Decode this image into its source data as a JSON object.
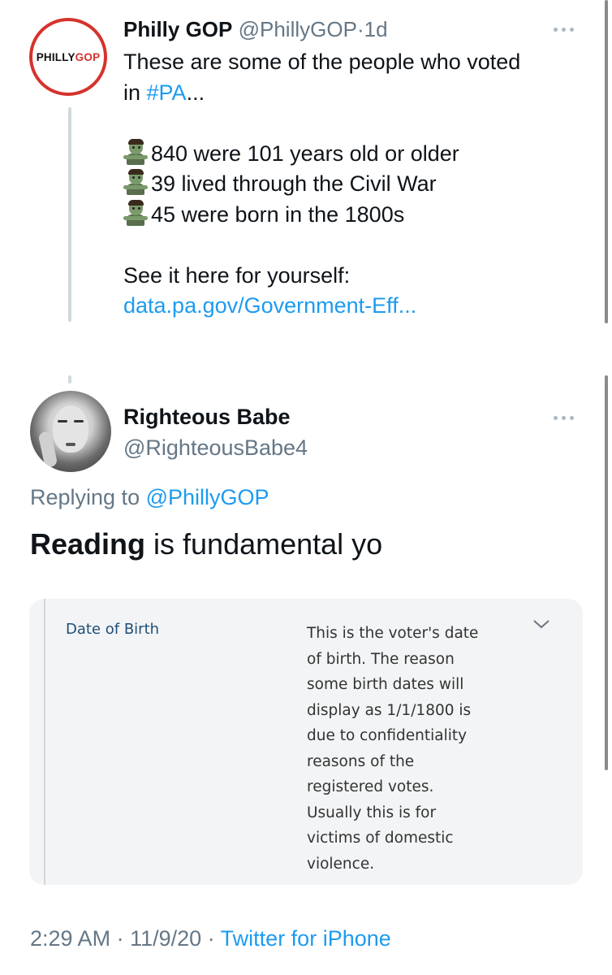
{
  "tweet1": {
    "logo": {
      "part1": "PHILLY",
      "part2": "GOP"
    },
    "name": "Philly GOP",
    "handle": "@PhillyGOP",
    "separator": "·",
    "time": "1d",
    "text": {
      "line1": "These are some of the people who voted",
      "line2_prefix": "in ",
      "hashtag": "#PA",
      "line2_suffix": "...",
      "stats": [
        "840 were 101 years old or older",
        "39 lived through the Civil War",
        "45 were born in the 1800s"
      ],
      "see": "See it here for yourself:",
      "link": "data.pa.gov/Government-Eff..."
    },
    "stat_icon": "zombie-emoji"
  },
  "tweet2": {
    "name": "Righteous Babe",
    "handle": "@RighteousBabe4",
    "replying_prefix": "Replying to ",
    "replying_handle": "@PhillyGOP",
    "text_bold": "Reading",
    "text_rest": " is fundamental yo",
    "card": {
      "label": "Date of Birth",
      "description_lines": [
        "This is the voter's date",
        "of birth. The reason",
        "some birth dates will",
        "display as 1/1/1800 is",
        "due to confidentiality",
        "reasons of the",
        "registered votes.",
        "Usually this is for",
        "victims of domestic",
        "violence."
      ],
      "expand_icon": "chevron-down-icon"
    },
    "footer": {
      "time": "2:29 AM",
      "sep1": " · ",
      "date": "11/9/20",
      "sep2": " · ",
      "source": "Twitter for iPhone"
    }
  },
  "colors": {
    "link": "#1d9bf0",
    "gray": "#657786",
    "logo_red": "#d6322c"
  }
}
